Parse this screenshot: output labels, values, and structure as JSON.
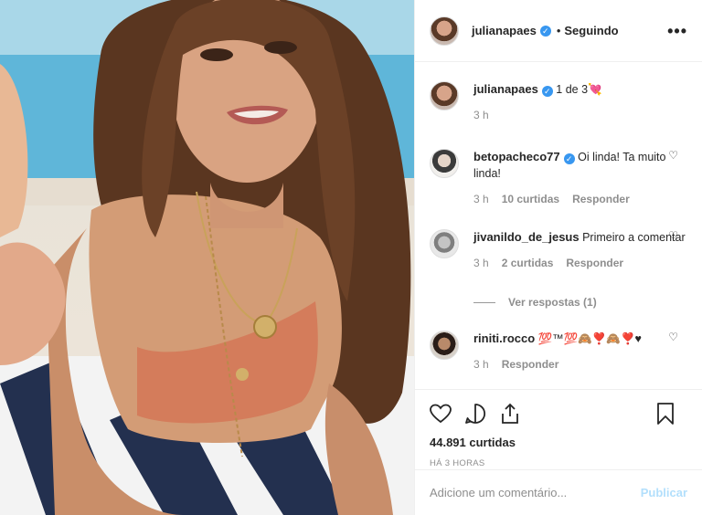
{
  "post": {
    "author": "julianapaes",
    "separator": "•",
    "follow_status": "Seguindo",
    "more": "•••"
  },
  "caption": {
    "username": "julianapaes",
    "text": "1 de 3💘",
    "time": "3 h"
  },
  "comments": [
    {
      "username": "betopacheco77",
      "verified": true,
      "text": "Oi linda! Ta muito linda!",
      "time": "3 h",
      "likes": "10 curtidas",
      "reply": "Responder"
    },
    {
      "username": "jivanildo_de_jesus",
      "verified": false,
      "text": "Primeiro a comentar",
      "time": "3 h",
      "likes": "2 curtidas",
      "reply": "Responder"
    },
    {
      "username": "riniti.rocco",
      "verified": false,
      "text": "💯™💯🙈❣️🙈❣️♥",
      "time": "3 h",
      "likes": "",
      "reply": "Responder"
    }
  ],
  "view_replies": "Ver respostas (1)",
  "likes_count": "44.891 curtidas",
  "posted_ago": "HÁ 3 HORAS",
  "add_comment": {
    "placeholder": "Adicione um comentário...",
    "submit": "Publicar"
  },
  "colors": {
    "verified": "#3897f0",
    "publish_disabled": "#b2dffc",
    "muted": "#8e8e8e"
  },
  "icons": [
    "heart-icon",
    "comment-icon",
    "share-icon",
    "bookmark-icon",
    "more-options-icon",
    "verified-badge-icon"
  ]
}
